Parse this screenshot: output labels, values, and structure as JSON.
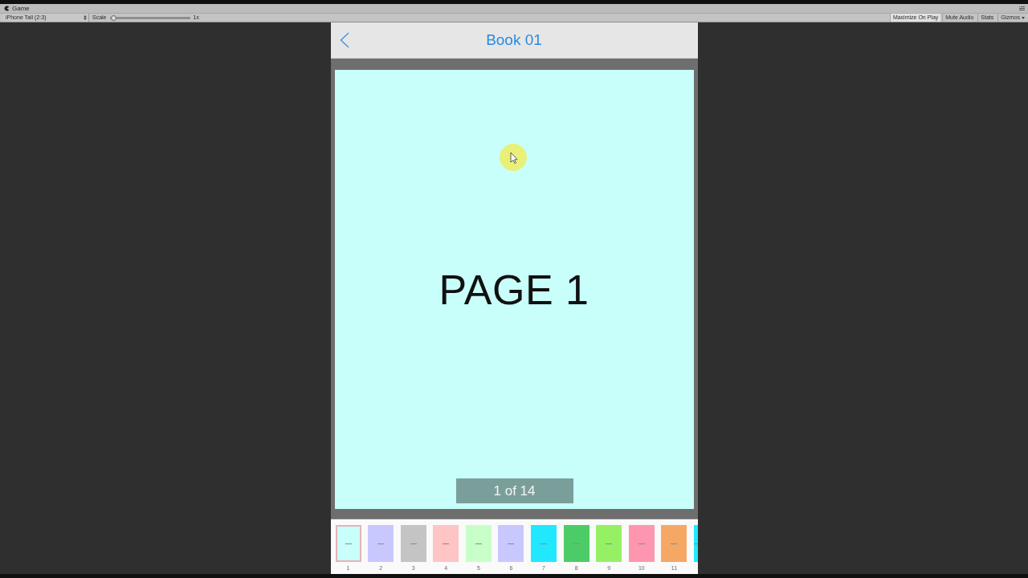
{
  "editor": {
    "tab": "Game",
    "toolbar": {
      "aspect": {
        "value": "iPhone Tall (2:3)"
      },
      "scale": {
        "label": "Scale",
        "level": 0.02,
        "reading": "1x"
      },
      "buttons": [
        {
          "label": "Maximize On Play",
          "kind": "toggle",
          "on": true
        },
        {
          "label": "Mute Audio",
          "kind": "toggle",
          "on": false
        },
        {
          "label": "Stats",
          "kind": "toggle",
          "on": false
        },
        {
          "label": "Gizmos",
          "kind": "dropdown",
          "on": false
        }
      ]
    }
  },
  "app": {
    "header": {
      "title": "Book 01"
    },
    "page": {
      "title": "PAGE 1",
      "indicator": "1 of 14"
    },
    "thumbnails": [
      {
        "label": "1",
        "color": "#c8fffa",
        "selected": true
      },
      {
        "label": "2",
        "color": "#c8c8ff",
        "selected": false
      },
      {
        "label": "3",
        "color": "#c4c4c4",
        "selected": false
      },
      {
        "label": "4",
        "color": "#ffc4c4",
        "selected": false
      },
      {
        "label": "5",
        "color": "#c8ffc8",
        "selected": false
      },
      {
        "label": "6",
        "color": "#c8c8ff",
        "selected": false
      },
      {
        "label": "7",
        "color": "#22e8ff",
        "selected": false
      },
      {
        "label": "8",
        "color": "#4ccc66",
        "selected": false
      },
      {
        "label": "9",
        "color": "#96f064",
        "selected": false
      },
      {
        "label": "10",
        "color": "#ff96b0",
        "selected": false
      },
      {
        "label": "11",
        "color": "#f5a864",
        "selected": false
      },
      {
        "color": "#22e8ff",
        "selected": false
      }
    ]
  }
}
